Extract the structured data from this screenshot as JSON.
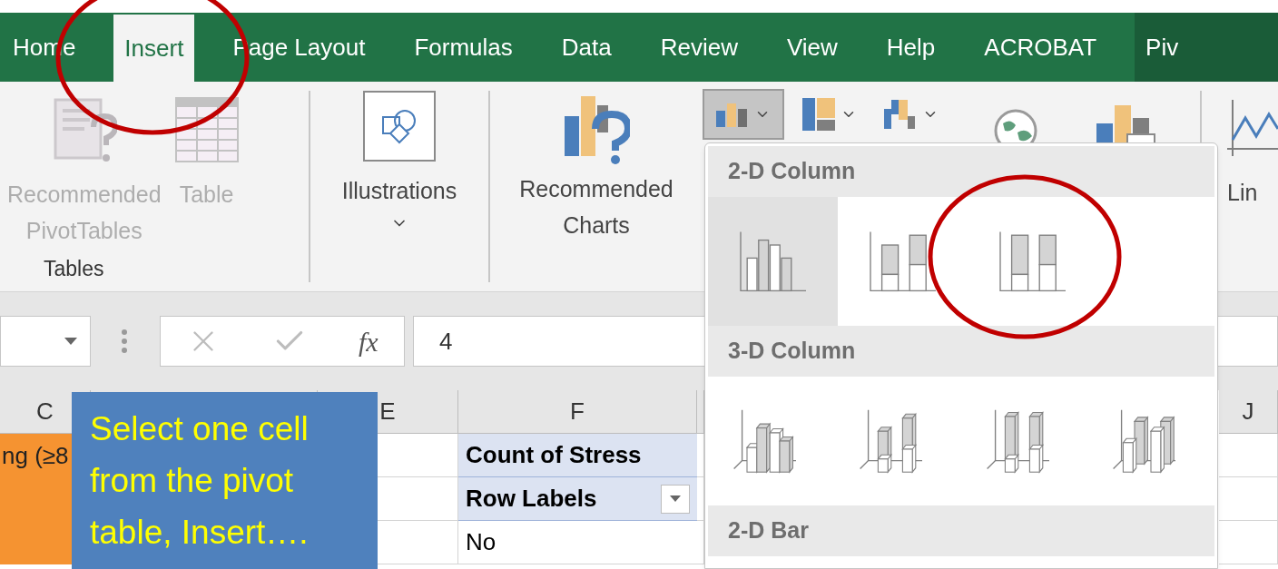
{
  "tabs": [
    {
      "label": "Home",
      "selected": false,
      "kind": "normal"
    },
    {
      "label": "Insert",
      "selected": true,
      "kind": "normal"
    },
    {
      "label": "Page Layout",
      "selected": false,
      "kind": "normal"
    },
    {
      "label": "Formulas",
      "selected": false,
      "kind": "normal"
    },
    {
      "label": "Data",
      "selected": false,
      "kind": "normal"
    },
    {
      "label": "Review",
      "selected": false,
      "kind": "normal"
    },
    {
      "label": "View",
      "selected": false,
      "kind": "normal"
    },
    {
      "label": "Help",
      "selected": false,
      "kind": "normal"
    },
    {
      "label": "ACROBAT",
      "selected": false,
      "kind": "normal"
    },
    {
      "label": "Piv",
      "selected": false,
      "kind": "contextual"
    }
  ],
  "ribbon": {
    "tables_group": {
      "label": "Tables",
      "buttons": [
        {
          "label": "Recommended\nPivotTables",
          "disabled": true
        },
        {
          "label": "Table",
          "disabled": true
        }
      ]
    },
    "illustrations": {
      "label": "Illustrations"
    },
    "recommended_charts": {
      "label": "Recommended\nCharts"
    },
    "sparkline": {
      "label": "Lin"
    }
  },
  "formula_bar": {
    "function_label": "fx",
    "value": "4"
  },
  "columns": [
    {
      "label": "C"
    },
    {},
    {
      "label": "E"
    },
    {
      "label": "F"
    },
    {},
    {
      "label": "J"
    }
  ],
  "rows": [
    {
      "c": "ng (≥8",
      "f": "Count of Stress",
      "kind": "header"
    },
    {
      "f": "Row Labels",
      "kind": "filter"
    },
    {
      "f": "No",
      "kind": "plain"
    }
  ],
  "callout": {
    "text": "Select one cell\nfrom the pivot\ntable, Insert…."
  },
  "chart_menu": {
    "sections": [
      {
        "title": "2-D Column",
        "items": [
          {
            "kind": "clustered",
            "selected": true
          },
          {
            "kind": "stacked",
            "selected": false
          },
          {
            "kind": "stacked100",
            "selected": false
          }
        ]
      },
      {
        "title": "3-D Column",
        "items": [
          {
            "kind": "clustered3d",
            "selected": false
          },
          {
            "kind": "stacked3d",
            "selected": false
          },
          {
            "kind": "percent3d",
            "selected": false
          },
          {
            "kind": "column3d",
            "selected": false
          }
        ]
      },
      {
        "title": "2-D Bar"
      }
    ]
  }
}
